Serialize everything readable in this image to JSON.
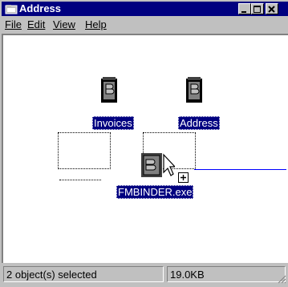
{
  "window": {
    "title": "Address"
  },
  "menu": {
    "file": "File",
    "edit": "Edit",
    "view": "View",
    "help": "Help"
  },
  "icons": [
    {
      "label": "Invoices",
      "icon": "binder-document-icon"
    },
    {
      "label": "Address",
      "icon": "binder-document-icon"
    }
  ],
  "drag": {
    "label": "FMBINDER.exe",
    "badge": "+",
    "icon": "binder-exe-icon"
  },
  "status": {
    "selection": "2 object(s) selected",
    "size": "19.0KB"
  },
  "colors": {
    "titlebar": "#000080",
    "chrome": "#c0c0c0",
    "selection": "#000080",
    "drag_line": "#0000ff"
  }
}
